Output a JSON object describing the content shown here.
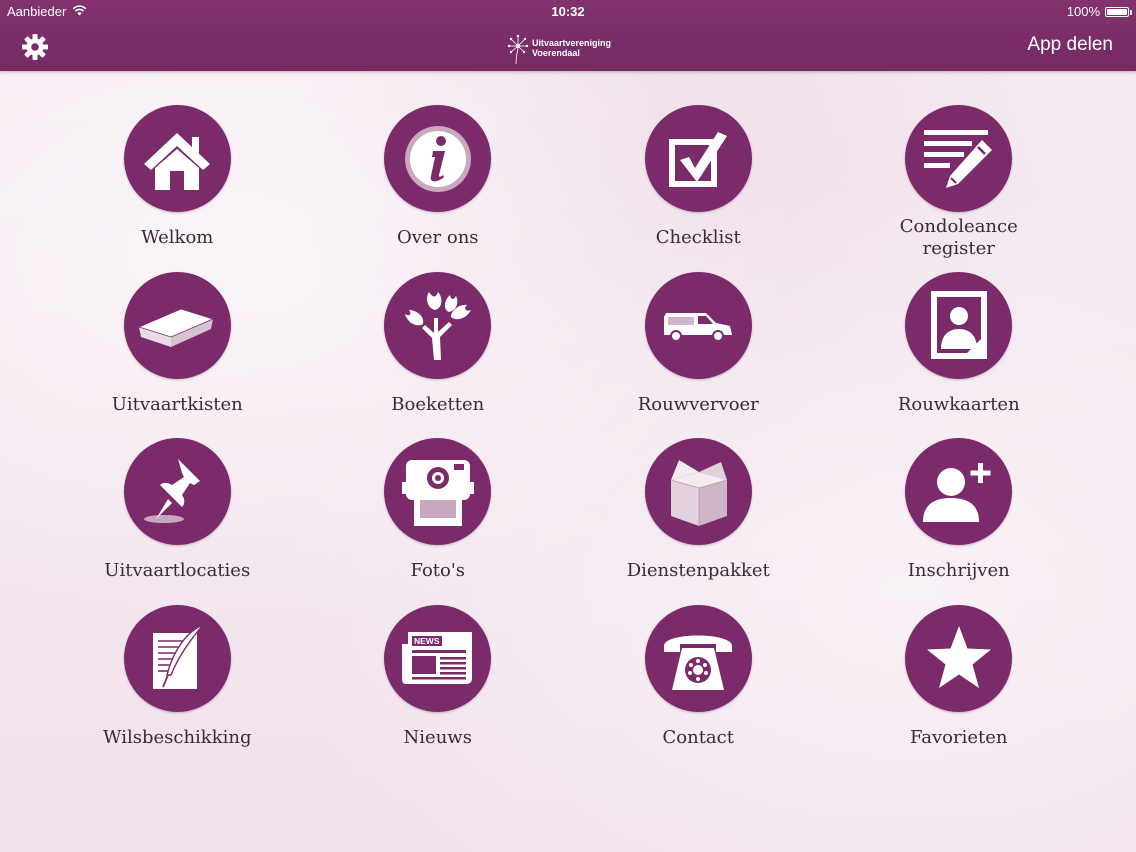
{
  "status_bar": {
    "carrier": "Aanbieder",
    "time": "10:32",
    "battery": "100%",
    "battery_level": 1.0
  },
  "nav": {
    "settings_icon": "gear-icon",
    "logo_line1": "Uitvaartvereniging",
    "logo_line2": "Voerendaal",
    "share_label": "App delen"
  },
  "colors": {
    "brand": "#7b2b6a",
    "bar": "#7a2d68",
    "background": "#f5e9f1",
    "label": "#3a2a38"
  },
  "tiles": [
    {
      "label": "Welkom",
      "icon": "house-icon"
    },
    {
      "label": "Over ons",
      "icon": "info-icon"
    },
    {
      "label": "Checklist",
      "icon": "checkbox-icon"
    },
    {
      "label_line1": "Condoleance",
      "label_line2": "register",
      "icon": "pencil-list-icon"
    },
    {
      "label": "Uitvaartkisten",
      "icon": "coffin-icon"
    },
    {
      "label": "Boeketten",
      "icon": "bouquet-icon"
    },
    {
      "label": "Rouwvervoer",
      "icon": "hearse-icon"
    },
    {
      "label": "Rouwkaarten",
      "icon": "portrait-card-icon"
    },
    {
      "label": "Uitvaartlocaties",
      "icon": "pushpin-icon"
    },
    {
      "label": "Foto's",
      "icon": "camera-icon"
    },
    {
      "label": "Dienstenpakket",
      "icon": "box-icon"
    },
    {
      "label": "Inschrijven",
      "icon": "add-person-icon"
    },
    {
      "label": "Wilsbeschikking",
      "icon": "quill-document-icon"
    },
    {
      "label": "Nieuws",
      "icon": "newspaper-icon"
    },
    {
      "label": "Contact",
      "icon": "phone-icon"
    },
    {
      "label": "Favorieten",
      "icon": "star-icon"
    }
  ]
}
